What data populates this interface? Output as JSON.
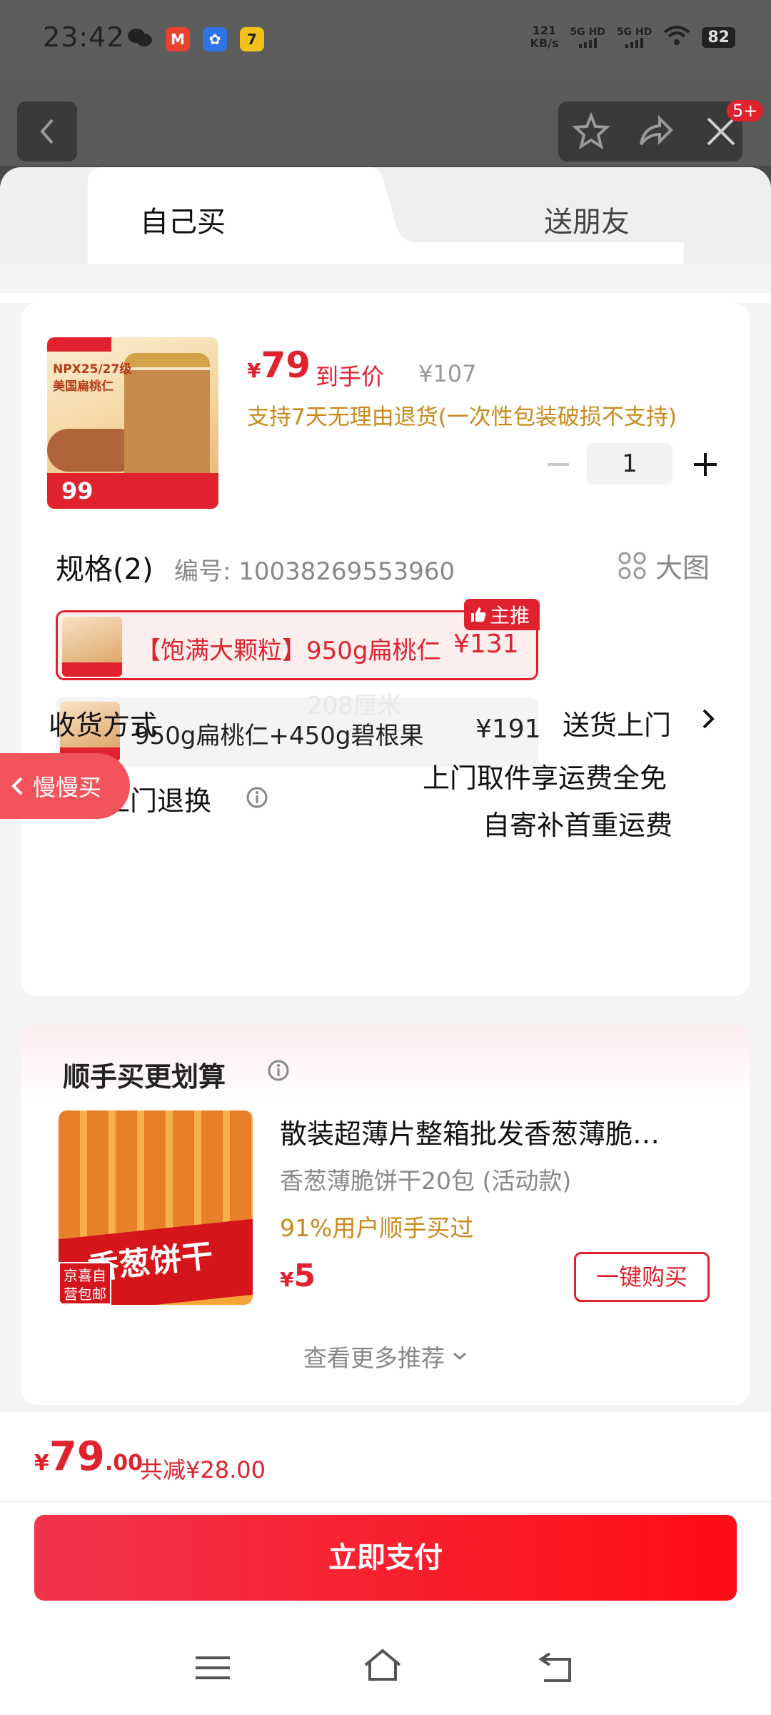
{
  "status_bar": {
    "time": "23:42",
    "net_speed": "121",
    "net_unit": "KB/s",
    "sig1": "5G HD",
    "sig2": "5G HD",
    "battery": "82"
  },
  "topnav": {
    "badge": "5+"
  },
  "tabs": {
    "self": "自己买",
    "gift": "送朋友"
  },
  "product": {
    "thumb_line1": "NPX25/27级",
    "thumb_line2": "美国扁桃仁",
    "thumb_price": "99",
    "price_symbol": "¥",
    "price": "79",
    "price_label": "到手价",
    "original_price": "¥107",
    "refund_note": "支持7天无理由退货(一次性包装破损不支持)",
    "quantity": "1"
  },
  "spec": {
    "title": "规格(2)",
    "code": "编号: 10038269553960",
    "big_image": "大图",
    "options": [
      {
        "label": "【饱满大颗粒】950g扁桃仁",
        "price": "¥131",
        "tag": "主推"
      },
      {
        "label": "950g扁桃仁+450g碧根果",
        "price": "¥191"
      }
    ]
  },
  "slow_buy": "慢慢买",
  "shipping": {
    "label": "收货方式",
    "value": "送货上门",
    "watermark": "208厘米"
  },
  "returns": {
    "label": "免费上门退换",
    "line1": "上门取件享运费全免",
    "line2": "自寄补首重运费"
  },
  "addon": {
    "title": "顺手买更划算",
    "thumb_text": "香葱饼干",
    "thumb_badge": "京喜自营包邮",
    "name": "散装超薄片整箱批发香葱薄脆…",
    "sub": "香葱薄脆饼干20包 (活动款)",
    "percent": "91%用户顺手买过",
    "price_symbol": "¥",
    "price": "5",
    "button": "一键购买",
    "more": "查看更多推荐"
  },
  "footer": {
    "symbol": "¥",
    "total_int": "79",
    "total_dec": ".00",
    "saving": "共减¥28.00",
    "pay_button": "立即支付"
  },
  "colors": {
    "accent": "#e0212e",
    "gold": "#c98a1a"
  }
}
